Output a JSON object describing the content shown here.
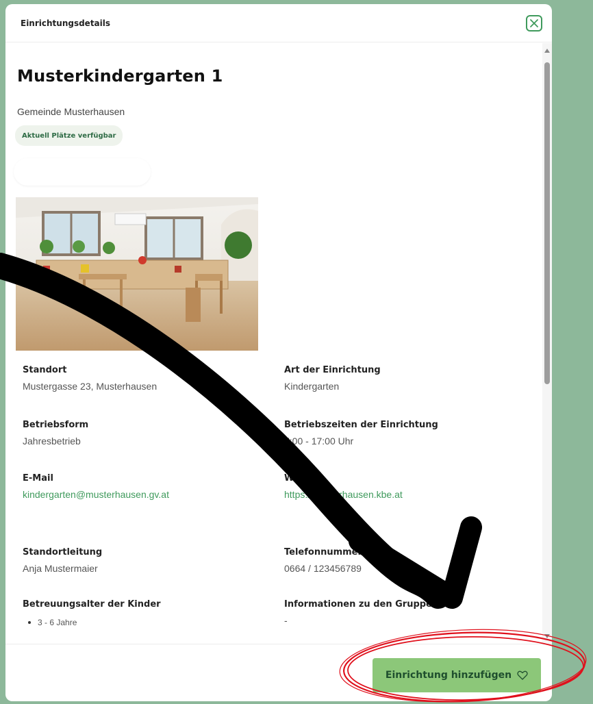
{
  "modal": {
    "title": "Einrichtungsdetails",
    "close_icon": "close-x-icon"
  },
  "facility": {
    "name": "Musterkindergarten 1",
    "municipality": "Gemeinde Musterhausen",
    "availability_badge": "Aktuell Plätze verfügbar"
  },
  "details": [
    {
      "label": "Standort",
      "value": "Mustergasse 23, Musterhausen",
      "link": false
    },
    {
      "label": "Art der Einrichtung",
      "value": "Kindergarten",
      "link": false
    },
    {
      "label": "Betriebsform",
      "value": "Jahresbetrieb",
      "link": false
    },
    {
      "label": "Betriebszeiten der Einrichtung",
      "value": "7:00 - 17:00 Uhr",
      "link": false
    },
    {
      "label": "E-Mail",
      "value": "kindergarten@musterhausen.gv.at",
      "link": true
    },
    {
      "label": "Website",
      "value": "https://musterhausen.kbe.at",
      "link": true
    },
    {
      "label": "Standortleitung",
      "value": "Anja Mustermaier",
      "link": false
    },
    {
      "label": "Telefonnummer",
      "value": "0664 / 123456789",
      "link": false
    },
    {
      "label": "Betreuungsalter der Kinder",
      "items": [
        "3 - 6 Jahre"
      ]
    },
    {
      "label": "Informationen zu den Gruppen",
      "value": "-",
      "link": false
    }
  ],
  "footer": {
    "add_button_label": "Einrichtung hinzufügen",
    "add_button_icon": "heart-outline-icon"
  },
  "colors": {
    "background": "#8db89a",
    "accent_green": "#3f9a5c",
    "button_green": "#8cc779",
    "annotation_red": "#e0101c",
    "annotation_arrow": "#000000"
  }
}
